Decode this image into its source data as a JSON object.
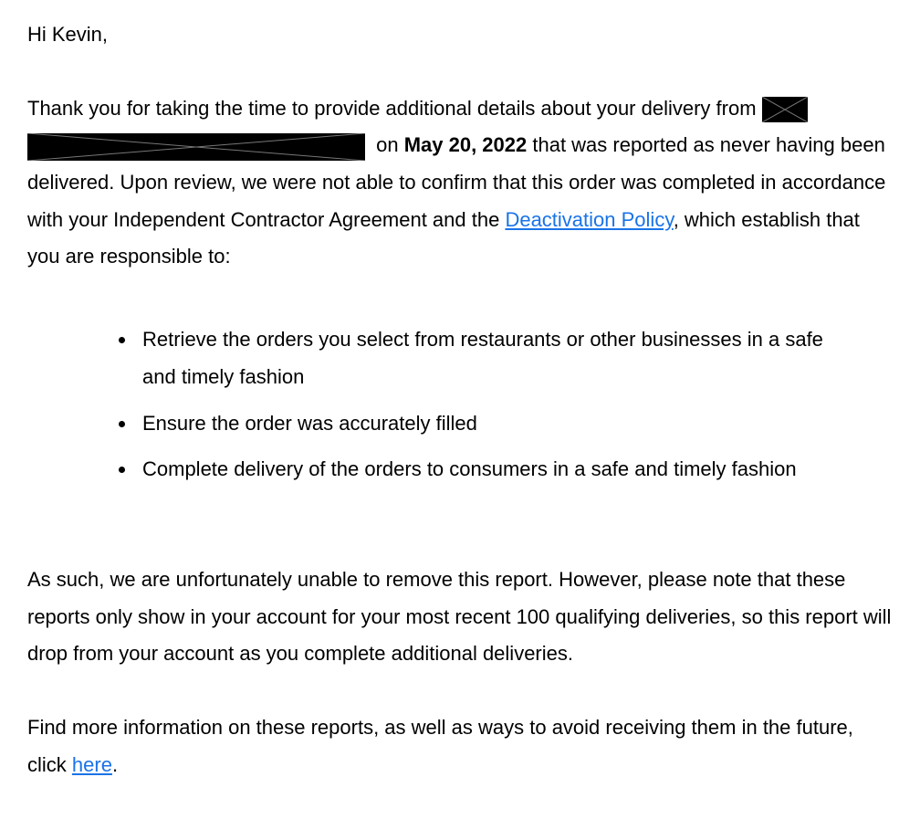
{
  "greeting": "Hi Kevin,",
  "para1": {
    "part1": "Thank you for taking the time to provide additional details about your delivery from",
    "part2_prefix": " on ",
    "date": "May 20, 2022",
    "part2_after_date": " that was reported as never having been delivered. Upon review, we were not able to confirm that this order was completed in accordance with your Independent Contractor Agreement and the ",
    "link_text": "Deactivation Policy",
    "part2_suffix": ", which establish that you are responsible to:"
  },
  "bullets": {
    "b1": "Retrieve the orders you select from restaurants or other businesses in a safe and timely fashion",
    "b2": "Ensure the order was accurately filled",
    "b3": "Complete delivery of the orders to consumers in a safe and timely fashion"
  },
  "para2": "As such, we are unfortunately unable to remove this report. However, please note that these reports only show in your account for your most recent 100 qualifying deliveries, so this report will drop from your account as you complete additional deliveries.",
  "para3": {
    "prefix": "Find more information on these reports, as well as ways to avoid receiving them in the future, click ",
    "link_text": "here",
    "suffix": "."
  }
}
